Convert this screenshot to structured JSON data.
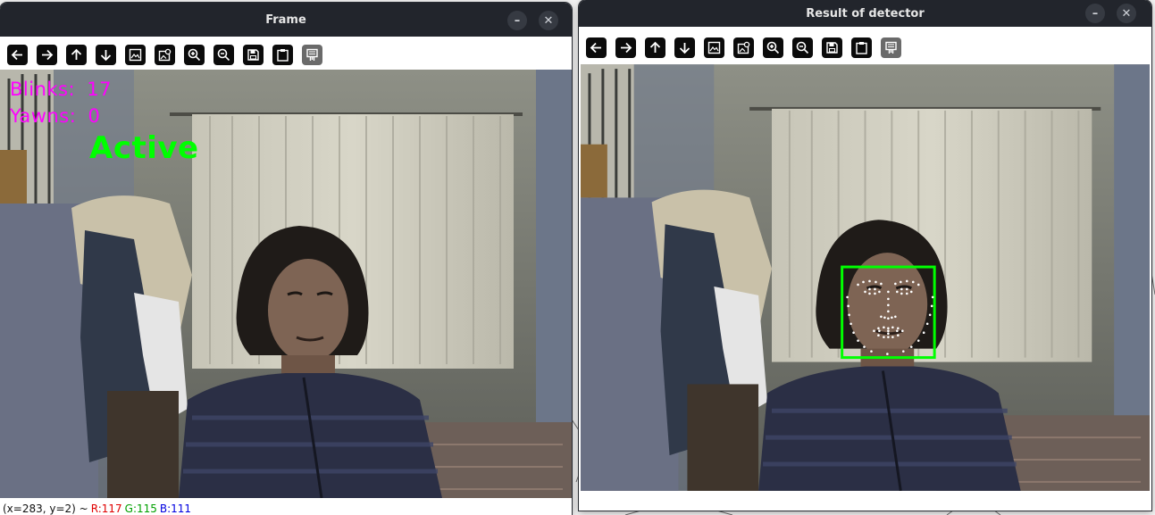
{
  "windows": {
    "frame": {
      "title": "Frame",
      "minimize_glyph": "–",
      "close_glyph": "✕",
      "overlay": {
        "blinks_label": "Blinks:",
        "blinks_value": "17",
        "yawns_label": "Yawns:",
        "yawns_value": "0",
        "state": "Active"
      },
      "status": {
        "coords": "(x=283, y=2) ~",
        "r": "R:117",
        "g": "G:115",
        "b": "B:111"
      }
    },
    "detector": {
      "title": "Result of detector",
      "minimize_glyph": "–",
      "close_glyph": "✕"
    }
  },
  "toolbar_icons": [
    "arrow-left-icon",
    "arrow-right-icon",
    "arrow-up-icon",
    "arrow-down-icon",
    "image-icon",
    "image-settings-icon",
    "zoom-in-icon",
    "zoom-out-icon",
    "save-icon",
    "clipboard-icon",
    "properties-icon"
  ],
  "colors": {
    "titlebar": "#22252c",
    "overlay_counts": "#ff00ff",
    "overlay_state": "#00ff00",
    "face_box": "#00ff00",
    "status_r": "#e00000",
    "status_g": "#00a000",
    "status_b": "#0000e0"
  }
}
